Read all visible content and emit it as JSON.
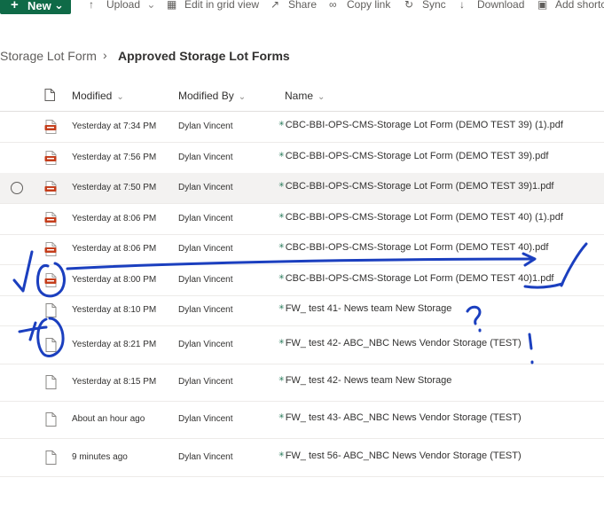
{
  "toolbar": {
    "new_label": "New",
    "items": [
      {
        "label": "Upload",
        "icon": "upload-icon"
      },
      {
        "label": "Edit in grid view",
        "icon": "grid-icon"
      },
      {
        "label": "Share",
        "icon": "share-icon"
      },
      {
        "label": "Copy link",
        "icon": "link-icon"
      },
      {
        "label": "Sync",
        "icon": "sync-icon"
      },
      {
        "label": "Download",
        "icon": "download-icon"
      },
      {
        "label": "Add shortcu",
        "icon": "shortcut-icon"
      }
    ]
  },
  "breadcrumb": {
    "root": "Storage Lot Form",
    "separator": "›",
    "current": "Approved Storage Lot Forms"
  },
  "columns": {
    "modified": "Modified",
    "modified_by": "Modified By",
    "name": "Name"
  },
  "rows": [
    {
      "modified": "Yesterday at 7:34 PM",
      "by": "Dylan Vincent",
      "name": "CBC-BBI-OPS-CMS-Storage Lot Form (DEMO TEST 39) (1).pdf",
      "type": "pdf"
    },
    {
      "modified": "Yesterday at 7:56 PM",
      "by": "Dylan Vincent",
      "name": "CBC-BBI-OPS-CMS-Storage Lot Form (DEMO TEST 39).pdf",
      "type": "pdf"
    },
    {
      "modified": "Yesterday at 7:50 PM",
      "by": "Dylan Vincent",
      "name": "CBC-BBI-OPS-CMS-Storage Lot Form (DEMO TEST 39)1.pdf",
      "type": "pdf"
    },
    {
      "modified": "Yesterday at 8:06 PM",
      "by": "Dylan Vincent",
      "name": "CBC-BBI-OPS-CMS-Storage Lot Form (DEMO TEST 40) (1).pdf",
      "type": "pdf"
    },
    {
      "modified": "Yesterday at 8:06 PM",
      "by": "Dylan Vincent",
      "name": "CBC-BBI-OPS-CMS-Storage Lot Form (DEMO TEST 40).pdf",
      "type": "pdf"
    },
    {
      "modified": "Yesterday at 8:00 PM",
      "by": "Dylan Vincent",
      "name": "CBC-BBI-OPS-CMS-Storage Lot Form (DEMO TEST 40)1.pdf",
      "type": "pdf"
    },
    {
      "modified": "Yesterday at 8:10 PM",
      "by": "Dylan Vincent",
      "name": "FW_ test 41- News team New Storage",
      "type": "file"
    },
    {
      "modified": "Yesterday at 8:21 PM",
      "by": "Dylan Vincent",
      "name": "FW_ test 42- ABC_NBC News Vendor Storage (TEST)",
      "type": "file"
    },
    {
      "modified": "Yesterday at 8:15 PM",
      "by": "Dylan Vincent",
      "name": "FW_ test 42- News team New Storage",
      "type": "file"
    },
    {
      "modified": "About an hour ago",
      "by": "Dylan Vincent",
      "name": "FW_ test 43- ABC_NBC News Vendor Storage (TEST)",
      "type": "file"
    },
    {
      "modified": "9 minutes ago",
      "by": "Dylan Vincent",
      "name": "FW_ test 56- ABC_NBC News Vendor Storage (TEST)",
      "type": "file"
    }
  ],
  "colors": {
    "accent": "#0f6a47",
    "pdf_red": "#c43e1c",
    "ink": "#1b3fbf"
  }
}
